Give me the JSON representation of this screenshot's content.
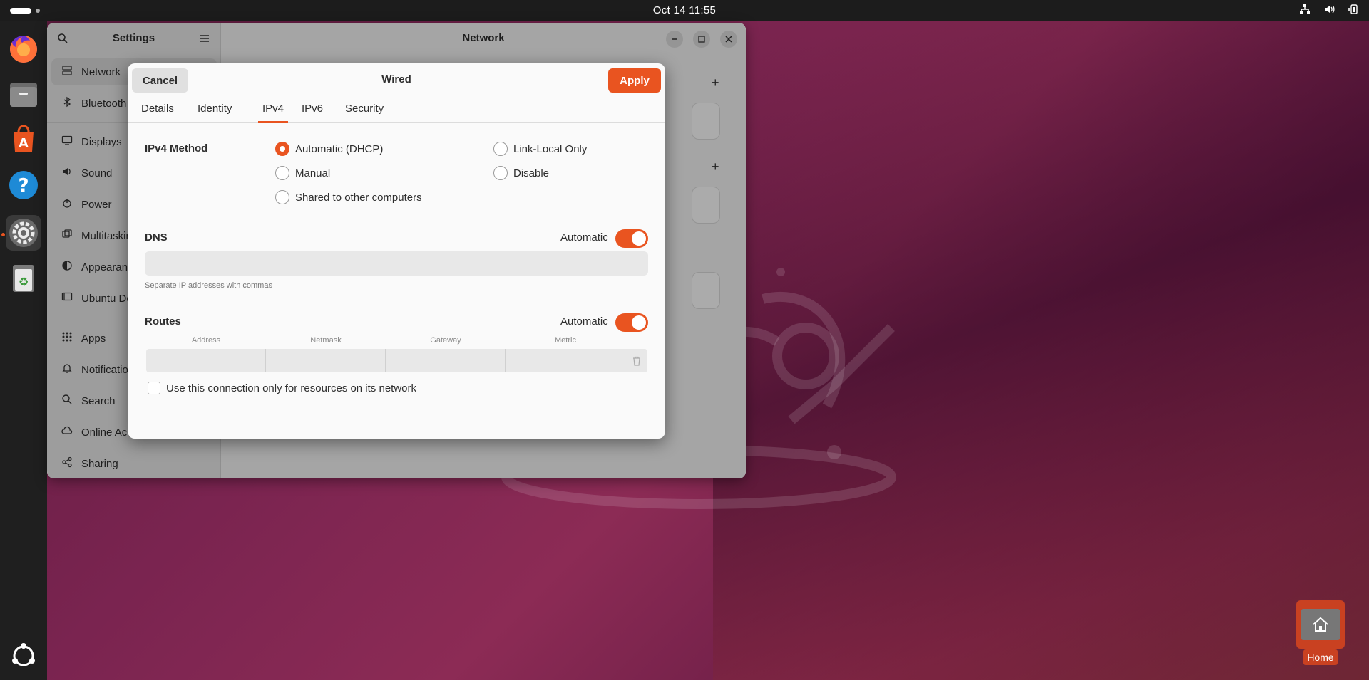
{
  "topbar": {
    "clock": "Oct 14  11:55"
  },
  "dock": {
    "items": [
      {
        "name": "firefox-icon"
      },
      {
        "name": "files-icon"
      },
      {
        "name": "app-center-icon"
      },
      {
        "name": "help-icon"
      },
      {
        "name": "settings-icon"
      },
      {
        "name": "trash-icon"
      },
      {
        "name": "show-apps-icon"
      }
    ]
  },
  "settings": {
    "title": "Settings",
    "page_title": "Network",
    "sidebar": [
      {
        "label": "Network",
        "icon": "network-icon"
      },
      {
        "label": "Bluetooth",
        "icon": "bluetooth-icon"
      },
      {
        "label": "Displays",
        "icon": "display-icon"
      },
      {
        "label": "Sound",
        "icon": "sound-icon"
      },
      {
        "label": "Power",
        "icon": "power-icon"
      },
      {
        "label": "Multitasking",
        "icon": "multitasking-icon"
      },
      {
        "label": "Appearance",
        "icon": "appearance-icon"
      },
      {
        "label": "Ubuntu Desktop",
        "icon": "ubuntu-desktop-icon"
      },
      {
        "label": "Apps",
        "icon": "apps-icon"
      },
      {
        "label": "Notifications",
        "icon": "bell-icon"
      },
      {
        "label": "Search",
        "icon": "search-icon"
      },
      {
        "label": "Online Accounts",
        "icon": "cloud-icon"
      },
      {
        "label": "Sharing",
        "icon": "share-icon"
      }
    ]
  },
  "dialog": {
    "title": "Wired",
    "cancel_label": "Cancel",
    "apply_label": "Apply",
    "tabs": [
      "Details",
      "Identity",
      "IPv4",
      "IPv6",
      "Security"
    ],
    "active_tab": "IPv4",
    "ipv4_method_label": "IPv4 Method",
    "methods": {
      "auto": "Automatic (DHCP)",
      "link_local": "Link-Local Only",
      "manual": "Manual",
      "disable": "Disable",
      "shared": "Shared to other computers"
    },
    "selected_method": "Automatic (DHCP)",
    "dns_label": "DNS",
    "dns_automatic_label": "Automatic",
    "dns_automatic": true,
    "dns_value": "",
    "dns_hint": "Separate IP addresses with commas",
    "routes_label": "Routes",
    "routes_automatic_label": "Automatic",
    "routes_automatic": true,
    "route_columns": [
      "Address",
      "Netmask",
      "Gateway",
      "Metric"
    ],
    "only_resources_label": "Use this connection only for resources on its network",
    "only_resources_checked": false
  },
  "desktop": {
    "home_label": "Home"
  },
  "colors": {
    "accent": "#e95420"
  }
}
